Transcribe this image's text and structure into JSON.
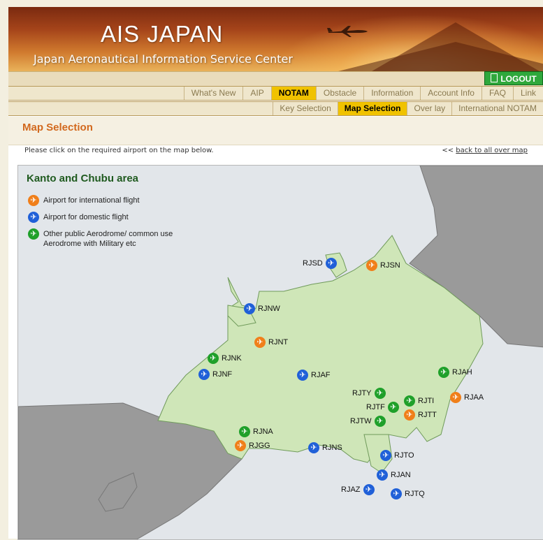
{
  "header": {
    "title": "AIS JAPAN",
    "subtitle": "Japan Aeronautical Information Service Center",
    "logout_label": "LOGOUT"
  },
  "nav": {
    "items": [
      "What's New",
      "AIP",
      "NOTAM",
      "Obstacle",
      "Information",
      "Account Info",
      "FAQ",
      "Link"
    ],
    "active": "NOTAM"
  },
  "subnav": {
    "items": [
      "Key Selection",
      "Map Selection",
      "Over lay",
      "International NOTAM"
    ],
    "active": "Map Selection"
  },
  "page": {
    "title": "Map Selection",
    "instruction": "Please click on the required airport on the map below.",
    "back_prefix": "<<",
    "back_link": "back to all over map"
  },
  "map": {
    "area_title": "Kanto and Chubu area",
    "legend": [
      {
        "type": "international",
        "label": "Airport for international flight"
      },
      {
        "type": "domestic",
        "label": "Airport for domestic flight"
      },
      {
        "type": "other",
        "label": "Other public Aerodrome/ common use",
        "label2": "Aerodrome with Military etc"
      }
    ],
    "colors": {
      "international": "#f07f1a",
      "domestic": "#2060d8",
      "other": "#1fa02a",
      "land_selected": "#cfe6b8",
      "land_other": "#9a9a9a",
      "sea": "#e2e6ea"
    },
    "airports": [
      {
        "code": "RJSD",
        "type": "domestic"
      },
      {
        "code": "RJSN",
        "type": "international"
      },
      {
        "code": "RJNW",
        "type": "domestic"
      },
      {
        "code": "RJNT",
        "type": "international"
      },
      {
        "code": "RJNK",
        "type": "other"
      },
      {
        "code": "RJNF",
        "type": "domestic"
      },
      {
        "code": "RJAF",
        "type": "domestic"
      },
      {
        "code": "RJAH",
        "type": "other"
      },
      {
        "code": "RJTY",
        "type": "other"
      },
      {
        "code": "RJAA",
        "type": "international"
      },
      {
        "code": "RJTI",
        "type": "other"
      },
      {
        "code": "RJTF",
        "type": "other"
      },
      {
        "code": "RJTT",
        "type": "international"
      },
      {
        "code": "RJTW",
        "type": "other"
      },
      {
        "code": "RJNA",
        "type": "other"
      },
      {
        "code": "RJGG",
        "type": "international"
      },
      {
        "code": "RJNS",
        "type": "domestic"
      },
      {
        "code": "RJTO",
        "type": "domestic"
      },
      {
        "code": "RJAN",
        "type": "domestic"
      },
      {
        "code": "RJAZ",
        "type": "domestic"
      },
      {
        "code": "RJTQ",
        "type": "domestic"
      }
    ]
  }
}
